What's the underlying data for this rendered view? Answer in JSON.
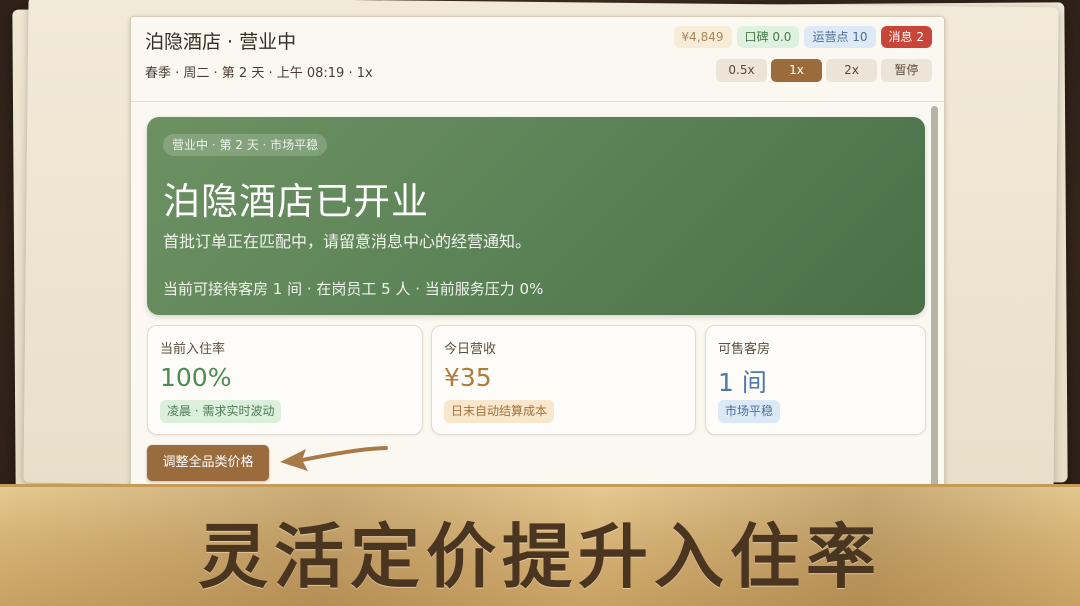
{
  "header": {
    "title": "泊隐酒店 · 营业中",
    "subtitle": "春季 · 周二 · 第 2 天 · 上午 08:19 · 1x",
    "stats": {
      "money": "¥4,849",
      "reputation": "口碑 0.0",
      "ops_points": "运营点 10",
      "messages": "消息 2"
    },
    "speeds": [
      "0.5x",
      "1x",
      "2x",
      "暂停"
    ],
    "active_speed": "1x"
  },
  "hero": {
    "pill": "营业中 · 第 2 天 · 市场平稳",
    "title": "泊隐酒店已开业",
    "description": "首批订单正在匹配中，请留意消息中心的经营通知。",
    "footer": "当前可接待客房 1 间 · 在岗员工 5 人 · 当前服务压力 0%"
  },
  "cards": [
    {
      "label": "当前入住率",
      "value": "100%",
      "tag": "凌晨 · 需求实时波动"
    },
    {
      "label": "今日营收",
      "value": "¥35",
      "tag": "日末自动结算成本"
    },
    {
      "label": "可售客房",
      "value": "1 间",
      "tag": "市场平稳"
    }
  ],
  "actions": {
    "adjust_price": "调整全品类价格"
  },
  "banner": {
    "text": "灵活定价提升入住率"
  },
  "colors": {
    "accent_brown": "#9b6b3c",
    "hero_green": "#5d8458",
    "message_red": "#c8453a"
  }
}
